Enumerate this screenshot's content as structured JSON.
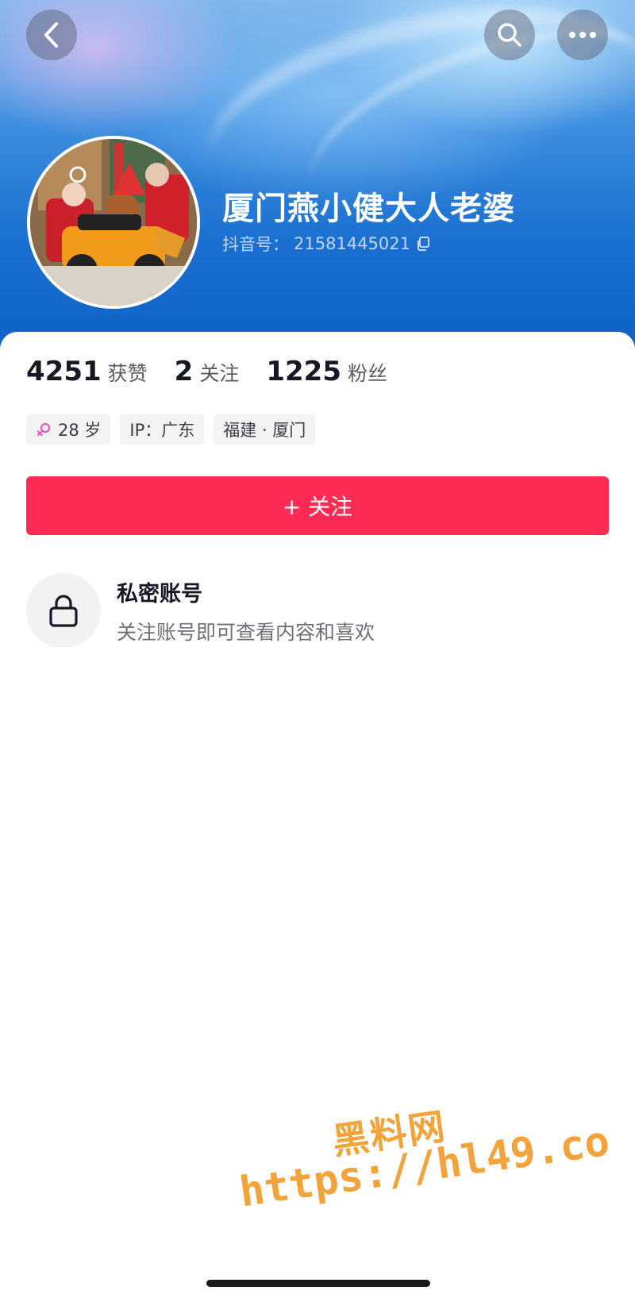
{
  "header": {
    "back_icon": "chevron-left-icon",
    "search_icon": "search-icon",
    "more_icon": "more-horizontal-icon"
  },
  "profile": {
    "name": "厦门燕小健大人老婆",
    "douyin_id_label": "抖音号：",
    "douyin_id": "21581445021",
    "copy_icon": "copy-icon"
  },
  "stats": [
    {
      "value": "4251",
      "label": "获赞"
    },
    {
      "value": "2",
      "label": "关注"
    },
    {
      "value": "1225",
      "label": "粉丝"
    }
  ],
  "tags": {
    "gender_age": "28 岁",
    "gender_color": "#f055c8",
    "ip": "IP：广东",
    "location": "福建 · 厦门"
  },
  "follow_button": {
    "label": "+ 关注",
    "color": "#fe2c55"
  },
  "private_notice": {
    "title": "私密账号",
    "subtitle": "关注账号即可查看内容和喜欢",
    "icon": "lock-icon"
  },
  "watermark": {
    "line1": "黑料网",
    "line2": "https://hl49.co"
  }
}
